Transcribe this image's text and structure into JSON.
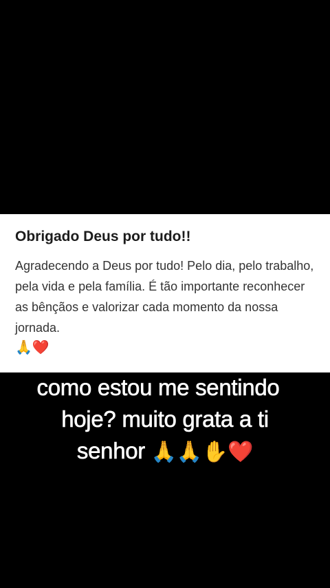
{
  "card": {
    "title": "Obrigado Deus por tudo!!",
    "body": "Agradecendo a Deus por tudo! Pelo dia, pelo trabalho, pela vida e pela família. É tão importante reconhecer as bênçãos e valorizar cada momento da nossa jornada.",
    "emoji": "🙏❤️"
  },
  "caption": {
    "line1": "como estou me sentindo",
    "line2": "hoje? muito grata a ti",
    "line3_text": "senhor",
    "line3_emoji": "🙏🙏✋❤️"
  },
  "colors": {
    "background": "#000000",
    "card_background": "#ffffff",
    "title_text": "#1c1c1c",
    "body_text": "#333333",
    "caption_text": "#ffffff"
  }
}
